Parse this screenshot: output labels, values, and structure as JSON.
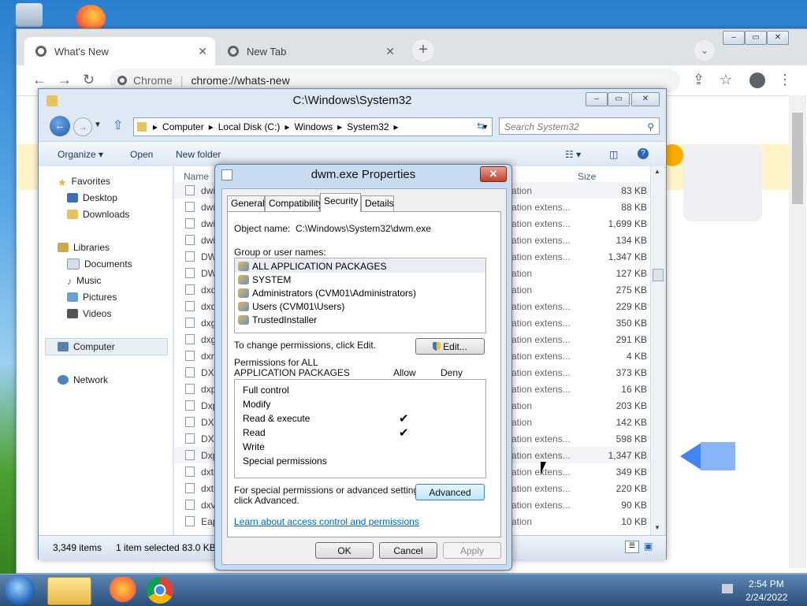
{
  "chrome": {
    "tabs": [
      {
        "label": "What's New"
      },
      {
        "label": "New Tab"
      }
    ],
    "new_tab_symbol": "+",
    "omnibox": {
      "scheme_label": "Chrome",
      "url": "chrome://whats-new"
    }
  },
  "explorer": {
    "title": "C:\\Windows\\System32",
    "breadcrumb": [
      "Computer",
      "Local Disk (C:)",
      "Windows",
      "System32"
    ],
    "search_placeholder": "Search System32",
    "commands": {
      "organize": "Organize ▾",
      "open": "Open",
      "new_folder": "New folder"
    },
    "nav": {
      "favorites": "Favorites",
      "desktop": "Desktop",
      "downloads": "Downloads",
      "libraries": "Libraries",
      "documents": "Documents",
      "music": "Music",
      "pictures": "Pictures",
      "videos": "Videos",
      "computer": "Computer",
      "network": "Network"
    },
    "columns": {
      "name": "Name",
      "size": "Size"
    },
    "files": [
      {
        "name": "dwi",
        "type": "ation",
        "size": "83 KB"
      },
      {
        "name": "dwi",
        "type": "ation extens...",
        "size": "88 KB"
      },
      {
        "name": "dwi",
        "type": "ation extens...",
        "size": "1,699 KB"
      },
      {
        "name": "dwi",
        "type": "ation extens...",
        "size": "134 KB"
      },
      {
        "name": "DW",
        "type": "ation extens...",
        "size": "1,347 KB"
      },
      {
        "name": "DW",
        "type": "ation",
        "size": "127 KB"
      },
      {
        "name": "dxdi",
        "type": "ation",
        "size": "275 KB"
      },
      {
        "name": "dxd",
        "type": "ation extens...",
        "size": "229 KB"
      },
      {
        "name": "dxg",
        "type": "ation extens...",
        "size": "350 KB"
      },
      {
        "name": "dxg",
        "type": "ation extens...",
        "size": "291 KB"
      },
      {
        "name": "dxm",
        "type": "ation extens...",
        "size": "4 KB"
      },
      {
        "name": "DXP",
        "type": "ation extens...",
        "size": "373 KB"
      },
      {
        "name": "dxp",
        "type": "ation extens...",
        "size": "16 KB"
      },
      {
        "name": "Dxp",
        "type": "ation",
        "size": "203 KB"
      },
      {
        "name": "DXP",
        "type": "ation",
        "size": "142 KB"
      },
      {
        "name": "DXP",
        "type": "ation extens...",
        "size": "598 KB"
      },
      {
        "name": "Dxp",
        "type": "ation extens...",
        "size": "1,347 KB"
      },
      {
        "name": "dxtr",
        "type": "ation extens...",
        "size": "349 KB"
      },
      {
        "name": "dxtr",
        "type": "ation extens...",
        "size": "220 KB"
      },
      {
        "name": "dxv",
        "type": "ation extens...",
        "size": "90 KB"
      },
      {
        "name": "Eap",
        "type": "ation",
        "size": "10 KB"
      }
    ],
    "status": {
      "count": "3,349 items",
      "selected": "1 item selected  83.0 KB"
    }
  },
  "dialog": {
    "title": "dwm.exe Properties",
    "close_symbol": "✕",
    "tabs": [
      "General",
      "Compatibility",
      "Security",
      "Details"
    ],
    "object_name_label": "Object name:",
    "object_name_value": "C:\\Windows\\System32\\dwm.exe",
    "group_label": "Group or user names:",
    "users": [
      "ALL APPLICATION PACKAGES",
      "SYSTEM",
      "Administrators (CVM01\\Administrators)",
      "Users (CVM01\\Users)",
      "TrustedInstaller"
    ],
    "change_text": "To change permissions, click Edit.",
    "edit_button": "Edit...",
    "permissions_for_line1": "Permissions for ALL",
    "permissions_for_line2": "APPLICATION PACKAGES",
    "allow_header": "Allow",
    "deny_header": "Deny",
    "permissions": [
      {
        "name": "Full control",
        "allow": ""
      },
      {
        "name": "Modify",
        "allow": ""
      },
      {
        "name": "Read & execute",
        "allow": "✔"
      },
      {
        "name": "Read",
        "allow": "✔"
      },
      {
        "name": "Write",
        "allow": ""
      },
      {
        "name": "Special permissions",
        "allow": ""
      }
    ],
    "special_text_line1": "For special permissions or advanced settings,",
    "special_text_line2": "click Advanced.",
    "advanced_button": "Advanced",
    "learn_link": "Learn about access control and permissions",
    "ok_button": "OK",
    "cancel_button": "Cancel",
    "apply_button": "Apply"
  },
  "taskbar": {
    "time": "2:54 PM",
    "date": "2/24/2022"
  },
  "colors": {
    "accent_blue": "#3c7fb1",
    "link": "#0066cc",
    "close_red": "#c2412c",
    "taskbar": "#2b4f7b"
  }
}
